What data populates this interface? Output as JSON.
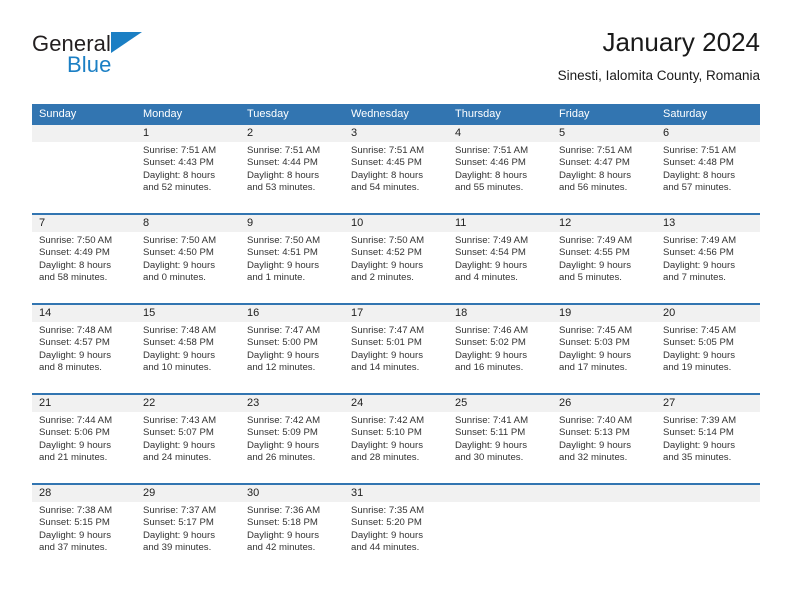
{
  "brand": {
    "line1": "General",
    "line2": "Blue",
    "accent_color": "#1b7fc4"
  },
  "header": {
    "title": "January 2024",
    "subtitle": "Sinesti, Ialomita County, Romania"
  },
  "theme": {
    "header_blue": "#3275b1",
    "daynum_band": "#f1f1f1",
    "text": "#333333"
  },
  "labels": {
    "sunrise_prefix": "Sunrise:",
    "sunset_prefix": "Sunset:",
    "daylight_prefix": "Daylight:"
  },
  "weekdays": [
    "Sunday",
    "Monday",
    "Tuesday",
    "Wednesday",
    "Thursday",
    "Friday",
    "Saturday"
  ],
  "weeks": [
    [
      {
        "day": "",
        "sunrise": "",
        "sunset": "",
        "daylight": ""
      },
      {
        "day": "1",
        "sunrise": "Sunrise: 7:51 AM",
        "sunset": "Sunset: 4:43 PM",
        "daylight": "Daylight: 8 hours and 52 minutes."
      },
      {
        "day": "2",
        "sunrise": "Sunrise: 7:51 AM",
        "sunset": "Sunset: 4:44 PM",
        "daylight": "Daylight: 8 hours and 53 minutes."
      },
      {
        "day": "3",
        "sunrise": "Sunrise: 7:51 AM",
        "sunset": "Sunset: 4:45 PM",
        "daylight": "Daylight: 8 hours and 54 minutes."
      },
      {
        "day": "4",
        "sunrise": "Sunrise: 7:51 AM",
        "sunset": "Sunset: 4:46 PM",
        "daylight": "Daylight: 8 hours and 55 minutes."
      },
      {
        "day": "5",
        "sunrise": "Sunrise: 7:51 AM",
        "sunset": "Sunset: 4:47 PM",
        "daylight": "Daylight: 8 hours and 56 minutes."
      },
      {
        "day": "6",
        "sunrise": "Sunrise: 7:51 AM",
        "sunset": "Sunset: 4:48 PM",
        "daylight": "Daylight: 8 hours and 57 minutes."
      }
    ],
    [
      {
        "day": "7",
        "sunrise": "Sunrise: 7:50 AM",
        "sunset": "Sunset: 4:49 PM",
        "daylight": "Daylight: 8 hours and 58 minutes."
      },
      {
        "day": "8",
        "sunrise": "Sunrise: 7:50 AM",
        "sunset": "Sunset: 4:50 PM",
        "daylight": "Daylight: 9 hours and 0 minutes."
      },
      {
        "day": "9",
        "sunrise": "Sunrise: 7:50 AM",
        "sunset": "Sunset: 4:51 PM",
        "daylight": "Daylight: 9 hours and 1 minute."
      },
      {
        "day": "10",
        "sunrise": "Sunrise: 7:50 AM",
        "sunset": "Sunset: 4:52 PM",
        "daylight": "Daylight: 9 hours and 2 minutes."
      },
      {
        "day": "11",
        "sunrise": "Sunrise: 7:49 AM",
        "sunset": "Sunset: 4:54 PM",
        "daylight": "Daylight: 9 hours and 4 minutes."
      },
      {
        "day": "12",
        "sunrise": "Sunrise: 7:49 AM",
        "sunset": "Sunset: 4:55 PM",
        "daylight": "Daylight: 9 hours and 5 minutes."
      },
      {
        "day": "13",
        "sunrise": "Sunrise: 7:49 AM",
        "sunset": "Sunset: 4:56 PM",
        "daylight": "Daylight: 9 hours and 7 minutes."
      }
    ],
    [
      {
        "day": "14",
        "sunrise": "Sunrise: 7:48 AM",
        "sunset": "Sunset: 4:57 PM",
        "daylight": "Daylight: 9 hours and 8 minutes."
      },
      {
        "day": "15",
        "sunrise": "Sunrise: 7:48 AM",
        "sunset": "Sunset: 4:58 PM",
        "daylight": "Daylight: 9 hours and 10 minutes."
      },
      {
        "day": "16",
        "sunrise": "Sunrise: 7:47 AM",
        "sunset": "Sunset: 5:00 PM",
        "daylight": "Daylight: 9 hours and 12 minutes."
      },
      {
        "day": "17",
        "sunrise": "Sunrise: 7:47 AM",
        "sunset": "Sunset: 5:01 PM",
        "daylight": "Daylight: 9 hours and 14 minutes."
      },
      {
        "day": "18",
        "sunrise": "Sunrise: 7:46 AM",
        "sunset": "Sunset: 5:02 PM",
        "daylight": "Daylight: 9 hours and 16 minutes."
      },
      {
        "day": "19",
        "sunrise": "Sunrise: 7:45 AM",
        "sunset": "Sunset: 5:03 PM",
        "daylight": "Daylight: 9 hours and 17 minutes."
      },
      {
        "day": "20",
        "sunrise": "Sunrise: 7:45 AM",
        "sunset": "Sunset: 5:05 PM",
        "daylight": "Daylight: 9 hours and 19 minutes."
      }
    ],
    [
      {
        "day": "21",
        "sunrise": "Sunrise: 7:44 AM",
        "sunset": "Sunset: 5:06 PM",
        "daylight": "Daylight: 9 hours and 21 minutes."
      },
      {
        "day": "22",
        "sunrise": "Sunrise: 7:43 AM",
        "sunset": "Sunset: 5:07 PM",
        "daylight": "Daylight: 9 hours and 24 minutes."
      },
      {
        "day": "23",
        "sunrise": "Sunrise: 7:42 AM",
        "sunset": "Sunset: 5:09 PM",
        "daylight": "Daylight: 9 hours and 26 minutes."
      },
      {
        "day": "24",
        "sunrise": "Sunrise: 7:42 AM",
        "sunset": "Sunset: 5:10 PM",
        "daylight": "Daylight: 9 hours and 28 minutes."
      },
      {
        "day": "25",
        "sunrise": "Sunrise: 7:41 AM",
        "sunset": "Sunset: 5:11 PM",
        "daylight": "Daylight: 9 hours and 30 minutes."
      },
      {
        "day": "26",
        "sunrise": "Sunrise: 7:40 AM",
        "sunset": "Sunset: 5:13 PM",
        "daylight": "Daylight: 9 hours and 32 minutes."
      },
      {
        "day": "27",
        "sunrise": "Sunrise: 7:39 AM",
        "sunset": "Sunset: 5:14 PM",
        "daylight": "Daylight: 9 hours and 35 minutes."
      }
    ],
    [
      {
        "day": "28",
        "sunrise": "Sunrise: 7:38 AM",
        "sunset": "Sunset: 5:15 PM",
        "daylight": "Daylight: 9 hours and 37 minutes."
      },
      {
        "day": "29",
        "sunrise": "Sunrise: 7:37 AM",
        "sunset": "Sunset: 5:17 PM",
        "daylight": "Daylight: 9 hours and 39 minutes."
      },
      {
        "day": "30",
        "sunrise": "Sunrise: 7:36 AM",
        "sunset": "Sunset: 5:18 PM",
        "daylight": "Daylight: 9 hours and 42 minutes."
      },
      {
        "day": "31",
        "sunrise": "Sunrise: 7:35 AM",
        "sunset": "Sunset: 5:20 PM",
        "daylight": "Daylight: 9 hours and 44 minutes."
      },
      {
        "day": "",
        "sunrise": "",
        "sunset": "",
        "daylight": ""
      },
      {
        "day": "",
        "sunrise": "",
        "sunset": "",
        "daylight": ""
      },
      {
        "day": "",
        "sunrise": "",
        "sunset": "",
        "daylight": ""
      }
    ]
  ]
}
